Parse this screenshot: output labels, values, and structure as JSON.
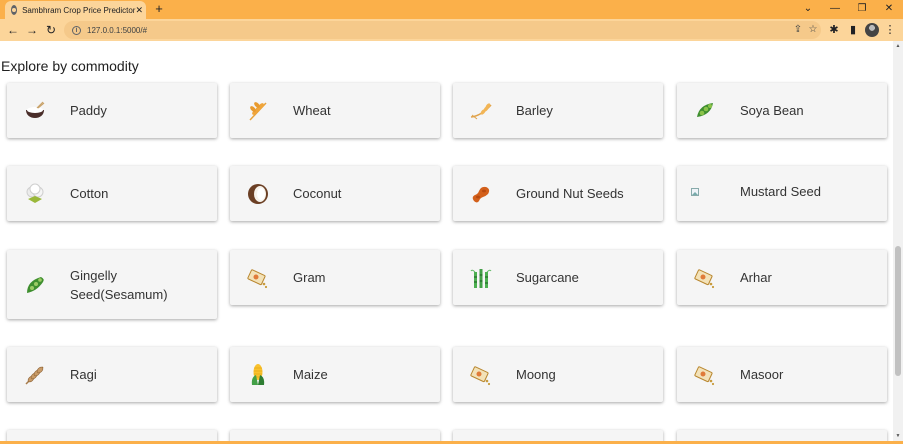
{
  "browser": {
    "tab_title": "Sambhram Crop Price Predictor",
    "tab_close": "✕",
    "new_tab": "+",
    "url": "127.0.0.1:5000/#",
    "controls": {
      "chevron": "⌄",
      "minimize": "—",
      "restore": "❐",
      "close": "✕"
    },
    "nav": {
      "back": "←",
      "forward": "→",
      "reload": "↻"
    },
    "menu": "⋮"
  },
  "page": {
    "section_title": "Explore by commodity",
    "commodities": [
      {
        "label": "Paddy",
        "icon": "rice-bowl-icon"
      },
      {
        "label": "Wheat",
        "icon": "wheat-icon"
      },
      {
        "label": "Barley",
        "icon": "barley-icon"
      },
      {
        "label": "Soya Bean",
        "icon": "soya-bean-icon"
      },
      {
        "label": "Cotton",
        "icon": "cotton-icon"
      },
      {
        "label": "Coconut",
        "icon": "coconut-icon"
      },
      {
        "label": "Ground Nut Seeds",
        "icon": "peanut-icon"
      },
      {
        "label": "Mustard Seed",
        "icon": "broken-image-icon"
      },
      {
        "label": "Gingelly Seed(Sesamum)",
        "icon": "pea-pod-icon"
      },
      {
        "label": "Gram",
        "icon": "seed-packet-icon"
      },
      {
        "label": "Sugarcane",
        "icon": "sugarcane-icon"
      },
      {
        "label": "Arhar",
        "icon": "seed-packet-icon"
      },
      {
        "label": "Ragi",
        "icon": "ragi-icon"
      },
      {
        "label": "Maize",
        "icon": "corn-icon"
      },
      {
        "label": "Moong",
        "icon": "seed-packet-icon"
      },
      {
        "label": "Masoor",
        "icon": "seed-packet-icon"
      }
    ]
  },
  "colors": {
    "tabstrip": "#fbb04a",
    "toolbar": "#fcd59a",
    "card": "#f5f5f5"
  }
}
